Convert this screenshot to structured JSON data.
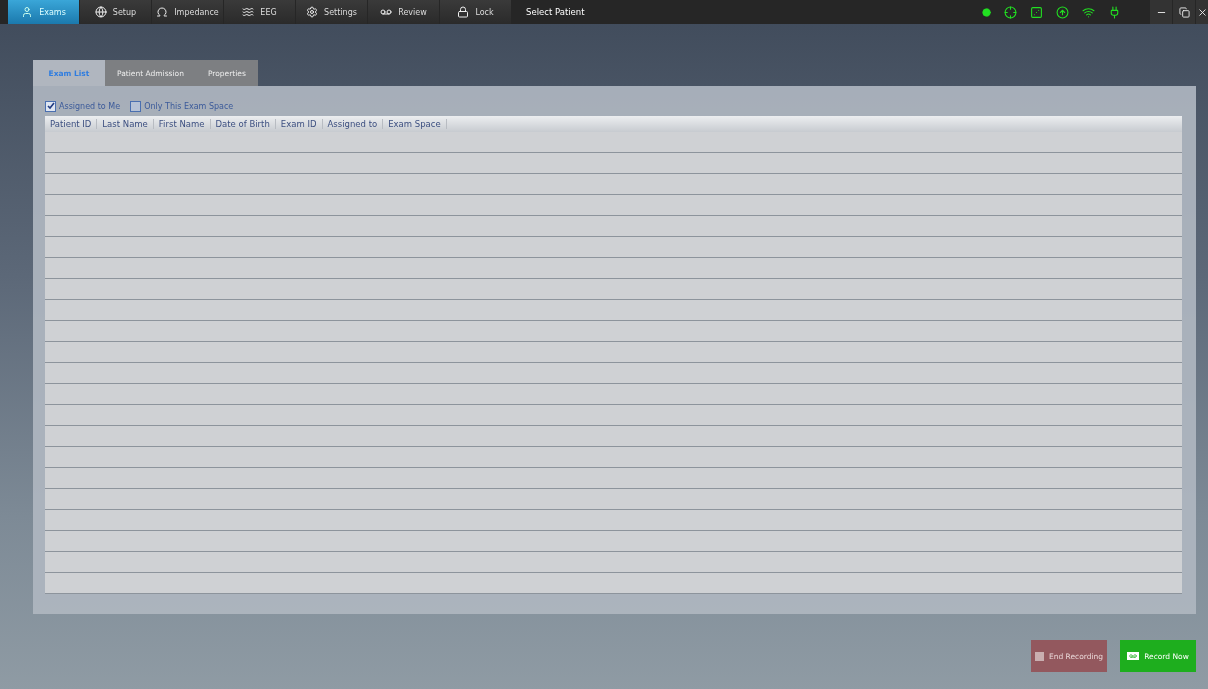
{
  "toolbar": {
    "items": [
      {
        "label": "Exams",
        "selected": true
      },
      {
        "label": "Setup",
        "selected": false
      },
      {
        "label": "Impedance",
        "selected": false
      },
      {
        "label": "EEG",
        "selected": false
      },
      {
        "label": "Settings",
        "selected": false
      },
      {
        "label": "Review",
        "selected": false
      },
      {
        "label": "Lock",
        "selected": false
      }
    ],
    "title": "Select Patient"
  },
  "tabs": [
    {
      "label": "Exam List",
      "selected": true
    },
    {
      "label": "Patient Admission",
      "selected": false
    },
    {
      "label": "Properties",
      "selected": false
    }
  ],
  "filters": [
    {
      "label": "Assigned to Me",
      "checked": true
    },
    {
      "label": "Only This Exam Space",
      "checked": false
    }
  ],
  "table": {
    "columns": [
      "Patient ID",
      "Last Name",
      "First Name",
      "Date of Birth",
      "Exam ID",
      "Assigned to",
      "Exam Space"
    ]
  },
  "buttons": [
    {
      "label": "End Recording",
      "kind": "stop",
      "disabled": true
    },
    {
      "label": "Record Now",
      "kind": "record",
      "disabled": false
    }
  ]
}
